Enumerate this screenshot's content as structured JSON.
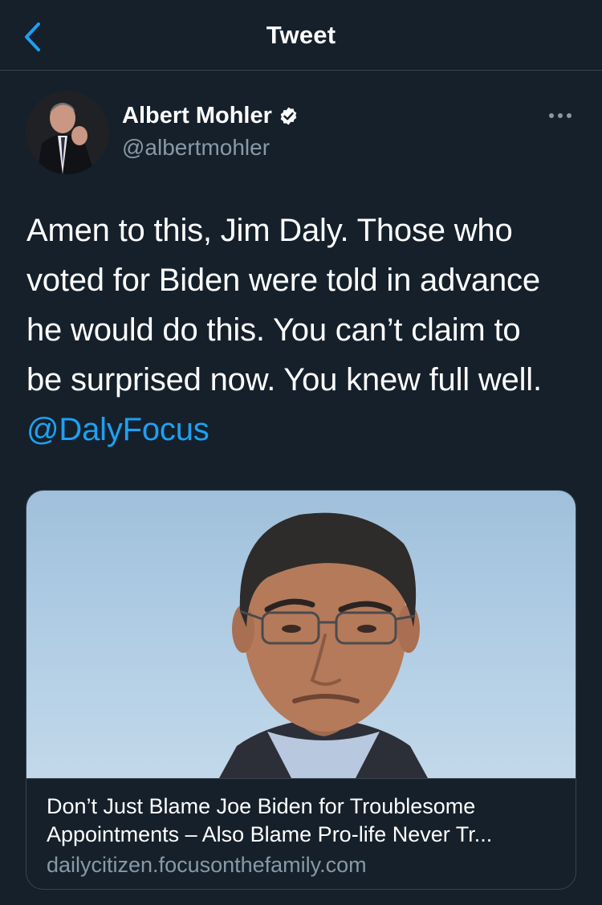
{
  "header": {
    "title": "Tweet",
    "back_icon": "chevron-left-icon"
  },
  "tweet": {
    "author": {
      "name": "Albert Mohler",
      "handle": "@albertmohler",
      "verified": true
    },
    "text_lines": [
      "Amen to this, Jim Daly. Those who",
      "voted for Biden were told in advance",
      "he would do this. You can’t claim to",
      "be surprised now. You knew full well."
    ],
    "mention": "@DalyFocus",
    "card": {
      "title_line1": "Don’t Just Blame Joe Biden for Troublesome",
      "title_line2": "Appointments – Also Blame Pro-life Never Tr...",
      "domain": "dailycitizen.focusonthefamily.com"
    }
  },
  "colors": {
    "background": "#15202b",
    "accent": "#1da1f2",
    "secondary_text": "#8899a6",
    "border": "#38444d"
  }
}
